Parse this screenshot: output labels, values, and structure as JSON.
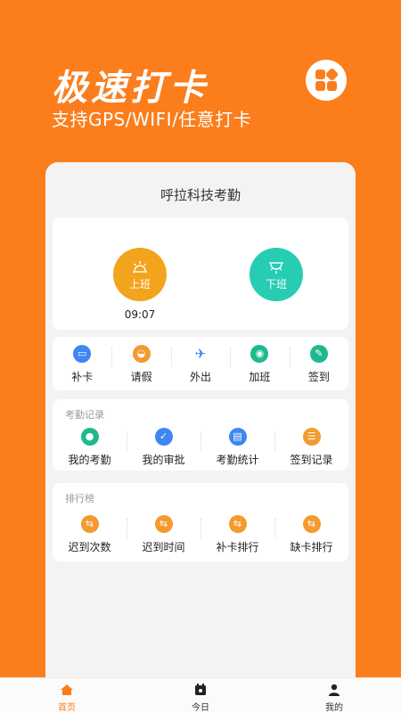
{
  "hero": {
    "title": "极速打卡",
    "subtitle": "支持GPS/WIFI/任意打卡",
    "menu_icon": "grid-menu-icon"
  },
  "colors": {
    "brand": "#fb7d1c",
    "punch_in": "#f3a41d",
    "punch_out": "#26cdb3",
    "blue_icon": "#3f86f2",
    "green_icon": "#1fb98f",
    "orange_icon": "#f49a2e"
  },
  "sheet": {
    "title": "呼拉科技考勤"
  },
  "punch": {
    "check_in": {
      "label": "上班",
      "icon": "sunrise-icon",
      "time": "09:07"
    },
    "check_out": {
      "label": "下班",
      "icon": "sunset-icon"
    }
  },
  "quick": [
    {
      "label": "补卡",
      "icon": "card-icon"
    },
    {
      "label": "请假",
      "icon": "car-icon"
    },
    {
      "label": "外出",
      "icon": "plane-icon"
    },
    {
      "label": "加班",
      "icon": "user-icon"
    },
    {
      "label": "签到",
      "icon": "pen-icon"
    }
  ],
  "records": {
    "section": "考勤记录",
    "items": [
      {
        "label": "我的考勤",
        "icon": "person-icon"
      },
      {
        "label": "我的审批",
        "icon": "approve-icon"
      },
      {
        "label": "考勤统计",
        "icon": "stats-icon"
      },
      {
        "label": "签到记录",
        "icon": "list-icon"
      }
    ]
  },
  "rank": {
    "section": "排行榜",
    "items": [
      {
        "label": "迟到次数",
        "icon": "swap-icon"
      },
      {
        "label": "迟到时间",
        "icon": "swap-icon"
      },
      {
        "label": "补卡排行",
        "icon": "swap-icon"
      },
      {
        "label": "缺卡排行",
        "icon": "swap-icon"
      }
    ]
  },
  "tabs": [
    {
      "label": "首页",
      "icon": "home-icon"
    },
    {
      "label": "今日",
      "icon": "calendar-icon"
    },
    {
      "label": "我的",
      "icon": "profile-icon"
    }
  ]
}
